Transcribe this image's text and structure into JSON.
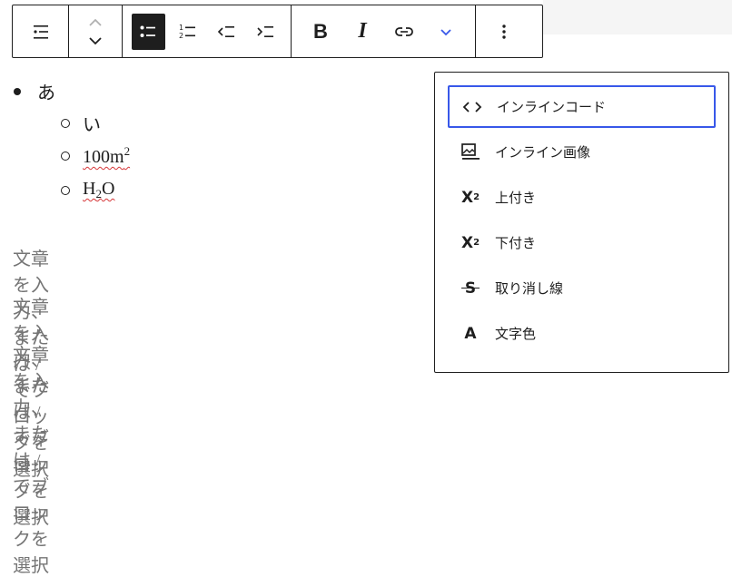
{
  "toolbar": {
    "bold_label": "B",
    "italic_label": "I",
    "ordered_numbers": [
      "1",
      "2"
    ]
  },
  "content": {
    "list_item": "あ",
    "nested": [
      {
        "text": "い"
      },
      {
        "base": "100m",
        "sup": "2"
      },
      {
        "pre": "H",
        "sub": "2",
        "post": "O"
      }
    ],
    "placeholders": [
      "文章を入力、または / でブロックを選択",
      "文章を入力、または / でブロックを選択",
      "文章を入力、または / でブロックを選択"
    ]
  },
  "dropdown": {
    "items": [
      {
        "label": "インラインコード",
        "icon": "code-icon"
      },
      {
        "label": "インライン画像",
        "icon": "image-icon"
      },
      {
        "label": "上付き",
        "icon": "superscript-icon",
        "symbol": "X",
        "mark": "2"
      },
      {
        "label": "下付き",
        "icon": "subscript-icon",
        "symbol": "X",
        "mark": "2"
      },
      {
        "label": "取り消し線",
        "icon": "strikethrough-icon",
        "symbol": "S"
      },
      {
        "label": "文字色",
        "icon": "text-color-icon",
        "symbol": "A"
      }
    ]
  },
  "colors": {
    "text": "#1e1e1e",
    "placeholder": "#757575",
    "focus": "#3858e9",
    "spell_error": "#d63638",
    "chevron_accent": "#3858e9"
  }
}
